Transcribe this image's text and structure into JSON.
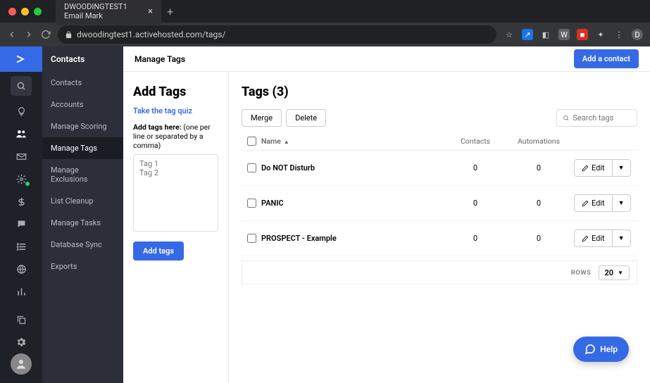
{
  "browser": {
    "tab_title": "DWOODINGTEST1 Email Mark",
    "url": "dwoodingtest1.activehosted.com/tags/"
  },
  "iconbar": {
    "items": [
      "search",
      "lightbulb",
      "contacts",
      "mail",
      "deals",
      "dollar",
      "conversations",
      "list",
      "globe",
      "reports"
    ],
    "bottom": [
      "settings",
      "avatar"
    ]
  },
  "subnav": {
    "header": "Contacts",
    "items": [
      {
        "label": "Contacts"
      },
      {
        "label": "Accounts"
      },
      {
        "label": "Manage Scoring"
      },
      {
        "label": "Manage Tags",
        "active": true
      },
      {
        "label": "Manage Exclusions"
      },
      {
        "label": "List Cleanup"
      },
      {
        "label": "Manage Tasks"
      },
      {
        "label": "Database Sync"
      },
      {
        "label": "Exports"
      }
    ]
  },
  "header": {
    "title": "Manage Tags",
    "add_contact": "Add a contact"
  },
  "add_tags": {
    "title": "Add Tags",
    "quiz_link": "Take the tag quiz",
    "hint_bold": "Add tags here:",
    "hint_rest": " (one per line or separated by a comma)",
    "placeholder": "Tag 1\nTag 2",
    "button": "Add tags"
  },
  "tags_panel": {
    "title": "Tags (3)",
    "merge": "Merge",
    "delete": "Delete",
    "search_placeholder": "Search tags",
    "columns": {
      "name": "Name",
      "contacts": "Contacts",
      "automations": "Automations"
    },
    "rows": [
      {
        "name": "Do NOT Disturb",
        "contacts": "0",
        "automations": "0",
        "edit": "Edit"
      },
      {
        "name": "PANIC",
        "contacts": "0",
        "automations": "0",
        "edit": "Edit"
      },
      {
        "name": "PROSPECT - Example",
        "contacts": "0",
        "automations": "0",
        "edit": "Edit"
      }
    ],
    "pagination": {
      "rows_label": "ROWS",
      "rows_value": "20"
    }
  },
  "help": {
    "label": "Help"
  }
}
